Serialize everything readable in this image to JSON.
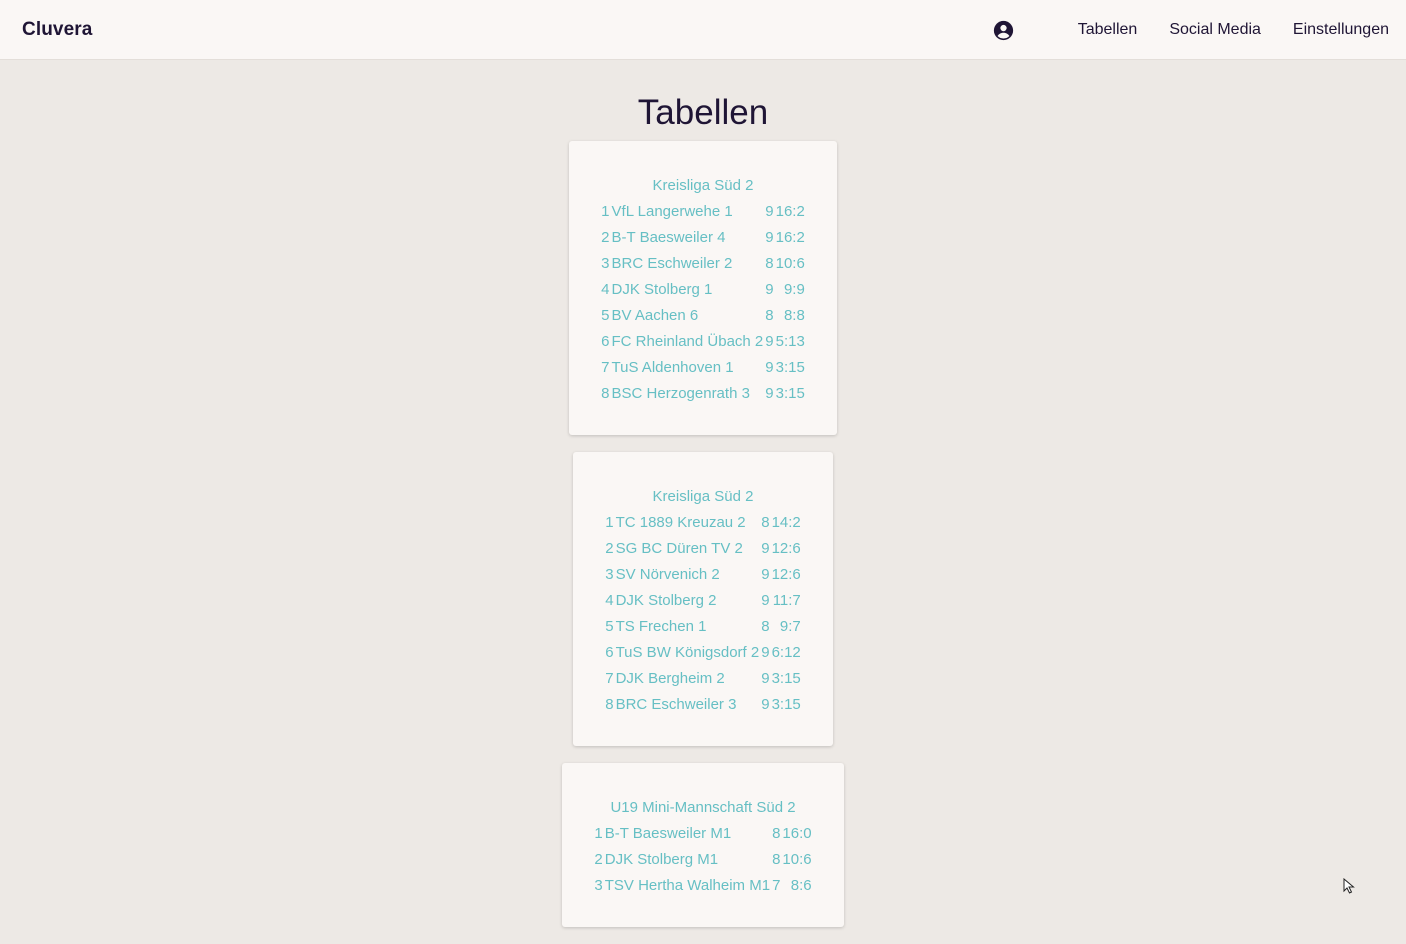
{
  "header": {
    "brand": "Cluvera",
    "account_icon": "account-circle-icon",
    "nav": [
      {
        "label": "Tabellen"
      },
      {
        "label": "Social Media"
      },
      {
        "label": "Einstellungen"
      }
    ]
  },
  "page": {
    "title": "Tabellen"
  },
  "tables": [
    {
      "title": "Kreisliga Süd 2",
      "rows": [
        {
          "rank": "1",
          "team": "VfL Langerwehe 1",
          "games": "9",
          "points": "16:2"
        },
        {
          "rank": "2",
          "team": "B-T Baesweiler 4",
          "games": "9",
          "points": "16:2"
        },
        {
          "rank": "3",
          "team": "BRC Eschweiler 2",
          "games": "8",
          "points": "10:6"
        },
        {
          "rank": "4",
          "team": "DJK Stolberg 1",
          "games": "9",
          "points": "9:9"
        },
        {
          "rank": "5",
          "team": "BV Aachen 6",
          "games": "8",
          "points": "8:8"
        },
        {
          "rank": "6",
          "team": "FC Rheinland Übach 2",
          "games": "9",
          "points": "5:13"
        },
        {
          "rank": "7",
          "team": "TuS Aldenhoven 1",
          "games": "9",
          "points": "3:15"
        },
        {
          "rank": "8",
          "team": "BSC Herzogenrath 3",
          "games": "9",
          "points": "3:15"
        }
      ]
    },
    {
      "title": "Kreisliga Süd 2",
      "rows": [
        {
          "rank": "1",
          "team": "TC 1889 Kreuzau 2",
          "games": "8",
          "points": "14:2"
        },
        {
          "rank": "2",
          "team": "SG BC Düren TV 2",
          "games": "9",
          "points": "12:6"
        },
        {
          "rank": "3",
          "team": "SV Nörvenich 2",
          "games": "9",
          "points": "12:6"
        },
        {
          "rank": "4",
          "team": "DJK Stolberg 2",
          "games": "9",
          "points": "11:7"
        },
        {
          "rank": "5",
          "team": "TS Frechen 1",
          "games": "8",
          "points": "9:7"
        },
        {
          "rank": "6",
          "team": "TuS BW Königsdorf 2",
          "games": "9",
          "points": "6:12"
        },
        {
          "rank": "7",
          "team": "DJK Bergheim 2",
          "games": "9",
          "points": "3:15"
        },
        {
          "rank": "8",
          "team": "BRC Eschweiler 3",
          "games": "9",
          "points": "3:15"
        }
      ]
    },
    {
      "title": "U19 Mini-Mannschaft Süd 2",
      "rows": [
        {
          "rank": "1",
          "team": "B-T Baesweiler M1",
          "games": "8",
          "points": "16:0"
        },
        {
          "rank": "2",
          "team": "DJK Stolberg M1",
          "games": "8",
          "points": "10:6"
        },
        {
          "rank": "3",
          "team": "TSV Hertha Walheim M1",
          "games": "7",
          "points": "8:6"
        }
      ]
    }
  ],
  "colors": {
    "background": "#ede9e5",
    "surface": "#faf7f5",
    "text_dark": "#1f1535",
    "accent_teal": "#66bfc4"
  }
}
